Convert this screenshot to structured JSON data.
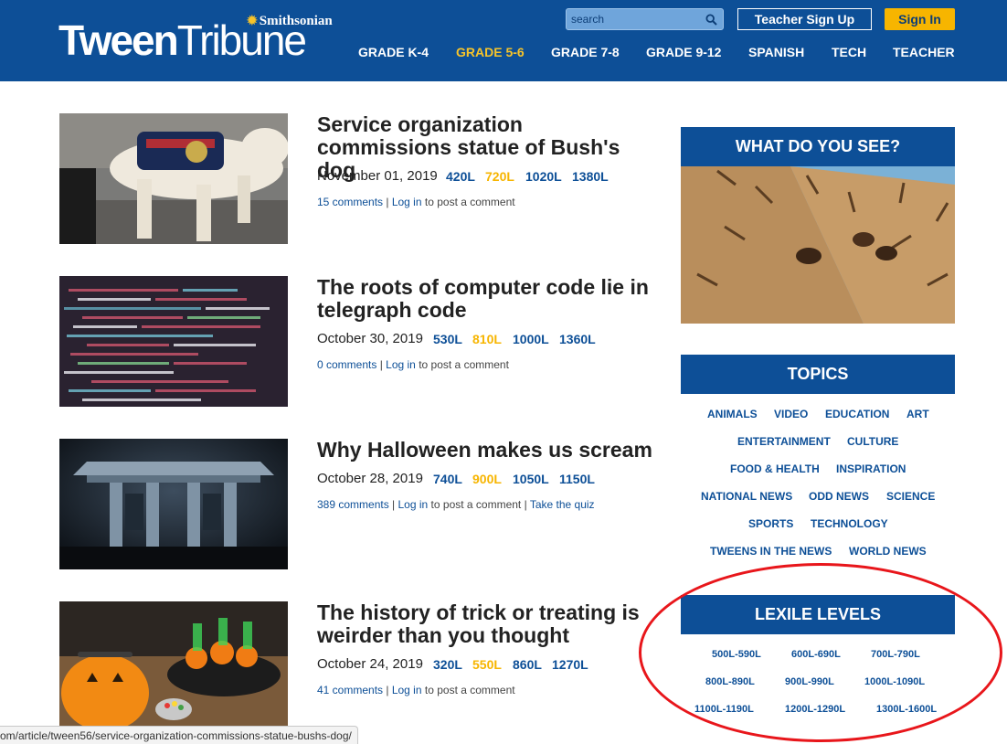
{
  "brand": {
    "smithsonian": "Smithsonian",
    "tween": "Tween",
    "tribune": "Tribune"
  },
  "search": {
    "placeholder": "search"
  },
  "header_buttons": {
    "teacher_signup": "Teacher Sign Up",
    "sign_in": "Sign In"
  },
  "nav": [
    "GRADE K-4",
    "GRADE 5-6",
    "GRADE 7-8",
    "GRADE 9-12",
    "SPANISH",
    "TECH",
    "TEACHER"
  ],
  "nav_active_index": 1,
  "articles": [
    {
      "title": "Service organization commissions statue of Bush's dog",
      "date": "November 01, 2019",
      "lexiles": [
        "420L",
        "720L",
        "1020L",
        "1380L"
      ],
      "highlight": 1,
      "comments": "15 comments",
      "login": "Log in",
      "post_text": "to post a comment",
      "quiz": ""
    },
    {
      "title": "The roots of computer code lie in telegraph code",
      "date": "October 30, 2019",
      "lexiles": [
        "530L",
        "810L",
        "1000L",
        "1360L"
      ],
      "highlight": 1,
      "comments": "0 comments",
      "login": "Log in",
      "post_text": "to post a comment",
      "quiz": ""
    },
    {
      "title": "Why Halloween makes us scream",
      "date": "October 28, 2019",
      "lexiles": [
        "740L",
        "900L",
        "1050L",
        "1150L"
      ],
      "highlight": 1,
      "comments": "389 comments",
      "login": "Log in",
      "post_text": "to post a comment",
      "quiz": "Take the quiz"
    },
    {
      "title": "The history of trick or treating is weirder than you thought",
      "date": "October 24, 2019",
      "lexiles": [
        "320L",
        "550L",
        "860L",
        "1270L"
      ],
      "highlight": 1,
      "comments": "41 comments",
      "login": "Log in",
      "post_text": "to post a comment",
      "quiz": ""
    }
  ],
  "sidebar": {
    "what_do_you_see": "WHAT DO YOU SEE?",
    "topics_title": "TOPICS",
    "topics": [
      "ANIMALS",
      "VIDEO",
      "EDUCATION",
      "ART",
      "ENTERTAINMENT",
      "CULTURE",
      "FOOD & HEALTH",
      "INSPIRATION",
      "NATIONAL NEWS",
      "ODD NEWS",
      "SCIENCE",
      "SPORTS",
      "TECHNOLOGY",
      "TWEENS IN THE NEWS",
      "WORLD NEWS"
    ],
    "lexile_title": "LEXILE LEVELS",
    "lexile_levels": [
      "500L-590L",
      "600L-690L",
      "700L-790L",
      "800L-890L",
      "900L-990L",
      "1000L-1090L",
      "1100L-1190L",
      "1200L-1290L",
      "1300L-1600L"
    ]
  },
  "status_bar": {
    "url": "om/article/tween56/service-organization-commissions-statue-bushs-dog/"
  },
  "colors": {
    "header_blue": "#0d4f97",
    "accent_yellow": "#f7b500",
    "annotation_red": "#e8161b"
  }
}
